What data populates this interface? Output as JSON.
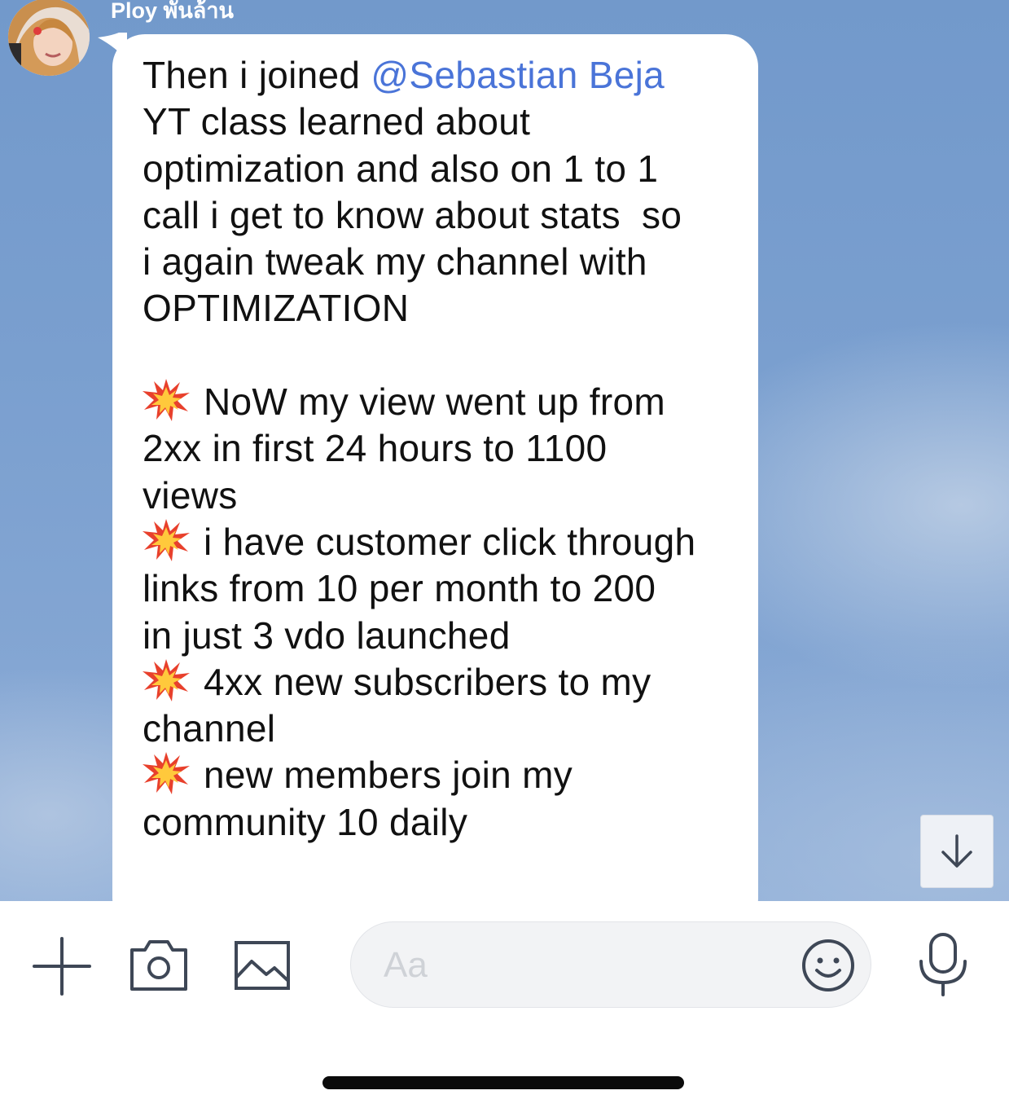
{
  "chat": {
    "sender_name": "Ploy พันล้าน",
    "message_lines": [
      {
        "parts": [
          {
            "text": "Then i joined "
          },
          {
            "text": "@Sebastian Beja",
            "mention": true
          }
        ]
      },
      {
        "parts": [
          {
            "text": "YT class learned about"
          }
        ]
      },
      {
        "parts": [
          {
            "text": "optimization and also on 1 to 1"
          }
        ]
      },
      {
        "parts": [
          {
            "text": "call i get to know about stats  so"
          }
        ]
      },
      {
        "parts": [
          {
            "text": "i again tweak my channel with"
          }
        ]
      },
      {
        "parts": [
          {
            "text": "OPTIMIZATION"
          }
        ]
      },
      {
        "parts": []
      },
      {
        "icon": "collision-emoji-icon",
        "parts": [
          {
            "text": "NoW my view went up from"
          }
        ]
      },
      {
        "parts": [
          {
            "text": "2xx in first 24 hours to 1100"
          }
        ]
      },
      {
        "parts": [
          {
            "text": "views"
          }
        ]
      },
      {
        "icon": "collision-emoji-icon",
        "parts": [
          {
            "text": "i have customer click through"
          }
        ]
      },
      {
        "parts": [
          {
            "text": "links from 10 per month to 200"
          }
        ]
      },
      {
        "parts": [
          {
            "text": "in just 3 vdo launched"
          }
        ]
      },
      {
        "icon": "collision-emoji-icon",
        "parts": [
          {
            "text": "4xx new subscribers to my"
          }
        ]
      },
      {
        "parts": [
          {
            "text": "channel"
          }
        ]
      },
      {
        "icon": "collision-emoji-icon",
        "parts": [
          {
            "text": "new members join my"
          }
        ]
      },
      {
        "parts": [
          {
            "text": "community 10 daily"
          }
        ]
      }
    ],
    "colors": {
      "background": "#7a9fcf",
      "bubble": "#ffffff",
      "mention": "#4a74d8",
      "text": "#111111",
      "icon": "#3e4756"
    }
  },
  "scroll_down_button": {
    "icon": "arrow-down-icon"
  },
  "input_bar": {
    "placeholder": "Aa",
    "icons": [
      "plus-icon",
      "camera-icon",
      "image-icon",
      "emoji-icon",
      "microphone-icon"
    ]
  }
}
